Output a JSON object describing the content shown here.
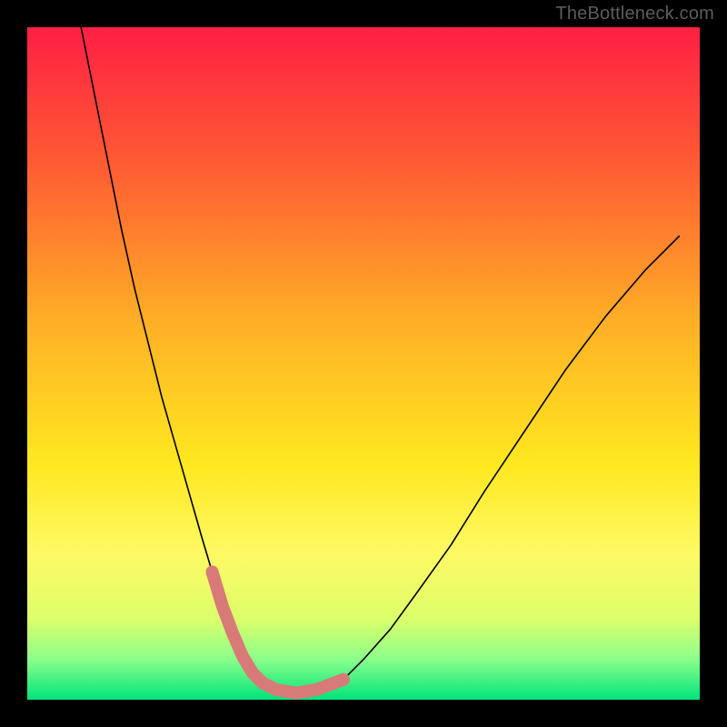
{
  "watermark": "TheBottleneck.com",
  "chart_data": {
    "type": "line",
    "title": "",
    "xlabel": "",
    "ylabel": "",
    "xlim": [
      0,
      100
    ],
    "ylim": [
      0,
      100
    ],
    "grid": false,
    "legend": false,
    "background_gradient_stops": [
      {
        "offset": 0.0,
        "color": "#ff1f44"
      },
      {
        "offset": 0.2,
        "color": "#ff5a33"
      },
      {
        "offset": 0.45,
        "color": "#ffb326"
      },
      {
        "offset": 0.65,
        "color": "#ffe81f"
      },
      {
        "offset": 0.78,
        "color": "#fff964"
      },
      {
        "offset": 0.88,
        "color": "#dcff6b"
      },
      {
        "offset": 0.94,
        "color": "#8bff8b"
      },
      {
        "offset": 1.0,
        "color": "#00e37a"
      }
    ],
    "series": [
      {
        "name": "bottleneck-curve",
        "stroke": "#000000",
        "stroke_width": 1.6,
        "x": [
          8,
          10,
          12,
          14,
          16,
          18,
          20,
          22,
          24,
          26,
          27.5,
          29,
          30.5,
          32,
          33.5,
          35,
          37,
          40,
          43,
          47,
          50,
          54,
          58,
          63,
          68,
          74,
          80,
          86,
          92,
          97
        ],
        "values": [
          100,
          90,
          80,
          70,
          61,
          53,
          45,
          38,
          31,
          24,
          19,
          14,
          10,
          6.5,
          4,
          2.5,
          1.5,
          1,
          1.5,
          3,
          6,
          10.5,
          16,
          23,
          31,
          40,
          49,
          57,
          64,
          69
        ]
      }
    ],
    "highlight_band": {
      "name": "optimal-range",
      "stroke": "#d87a78",
      "stroke_width": 14,
      "linecap": "round",
      "points_x": [
        27.5,
        29,
        30.5,
        32,
        33.5,
        35,
        37,
        40,
        43,
        47
      ],
      "points_values": [
        19,
        14,
        10,
        6.5,
        4,
        2.5,
        1.5,
        1,
        1.5,
        3
      ],
      "dot_indices": [
        0,
        9
      ]
    }
  }
}
